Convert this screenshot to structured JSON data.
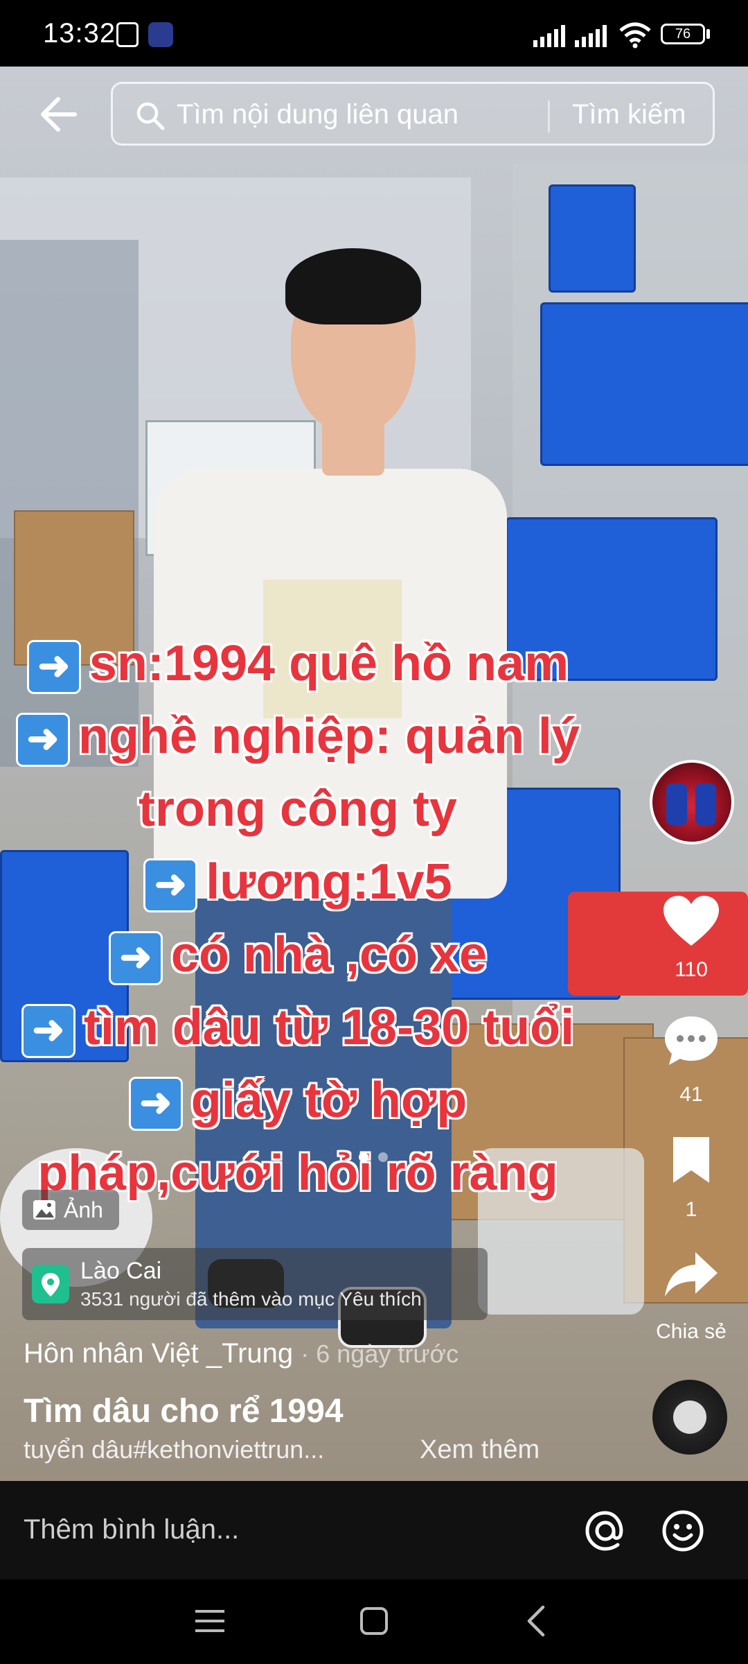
{
  "status_bar": {
    "time": "13:32",
    "battery": "76"
  },
  "search": {
    "placeholder": "Tìm nội dung liên quan",
    "submit_label": "Tìm kiếm"
  },
  "caption_lines": [
    {
      "text": "sn:1994 quê hồ nam",
      "arrow": true
    },
    {
      "text": "nghề nghiệp: quản lý",
      "arrow": true
    },
    {
      "text": "trong công ty",
      "arrow": false
    },
    {
      "text": "lương:1v5",
      "arrow": true
    },
    {
      "text": "có nhà ,có xe",
      "arrow": true
    },
    {
      "text": "tìm dâu từ 18-30 tuổi",
      "arrow": true
    },
    {
      "text": "giấy tờ hợp",
      "arrow": true
    },
    {
      "text": "pháp,cưới hỏi rõ ràng",
      "arrow": false
    }
  ],
  "actions": {
    "likes": "110",
    "comments": "41",
    "saves": "1",
    "share_label": "Chia sẻ"
  },
  "photo_tag": "Ảnh",
  "location": {
    "name": "Lào Cai",
    "subtitle": "3531 người đã thêm vào mục Yêu thích"
  },
  "post": {
    "author": "Hôn nhân Việt _Trung",
    "time": "· 6 ngày trước",
    "title": "Tìm dâu cho rể 1994",
    "description": "tuyển dâu#kethonviettrun...",
    "see_more": "Xem thêm"
  },
  "comment_bar": {
    "placeholder": "Thêm bình luận..."
  },
  "colors": {
    "caption_text": "#e8343d",
    "caption_outline": "#ffffff",
    "arrow_box": "#3a8fe0",
    "location_icon": "#1fbf8f"
  }
}
